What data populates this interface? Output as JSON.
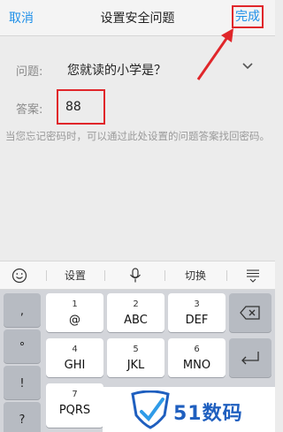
{
  "header": {
    "cancel_label": "取消",
    "title": "设置安全问题",
    "done_label": "完成"
  },
  "form": {
    "question_label": "问题:",
    "question_value": "您就读的小学是？",
    "answer_label": "答案:",
    "answer_value": "88",
    "hint": "当您忘记密码时，可以通过此处设置的问题答案找回密码。"
  },
  "keyboard": {
    "toolbar": {
      "emoji_icon": "emoji-icon",
      "settings_label": "设置",
      "mic_icon": "microphone-icon",
      "switch_label": "切换",
      "collapse_icon": "keyboard-collapse-icon"
    },
    "side_keys": [
      ",",
      "°",
      "!",
      "?"
    ],
    "keys": [
      {
        "num": "1",
        "letters": "@"
      },
      {
        "num": "2",
        "letters": "ABC"
      },
      {
        "num": "3",
        "letters": "DEF"
      },
      {
        "num": "4",
        "letters": "GHI"
      },
      {
        "num": "5",
        "letters": "JKL"
      },
      {
        "num": "6",
        "letters": "MNO"
      },
      {
        "num": "7",
        "letters": "PQRS"
      }
    ],
    "backspace_icon": "backspace-icon",
    "enter_icon": "enter-icon"
  },
  "watermark": {
    "text": "51数码"
  },
  "colors": {
    "accent": "#1e8fe8",
    "annotation": "#e0262a",
    "watermark": "#1f5fbf"
  }
}
